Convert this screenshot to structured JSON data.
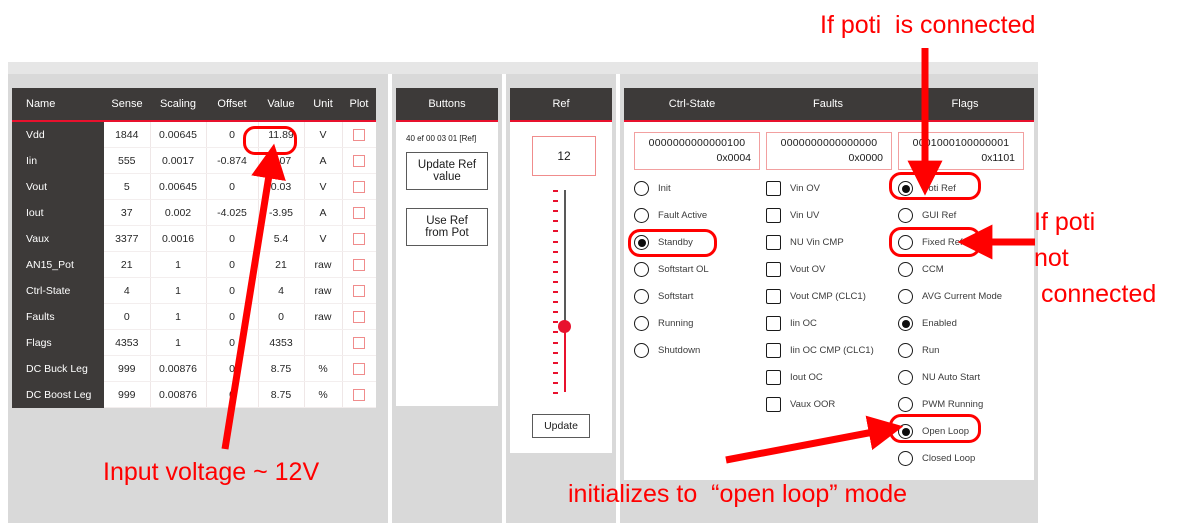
{
  "table": {
    "columns": [
      "Name",
      "Sense",
      "Scaling",
      "Offset",
      "Value",
      "Unit",
      "Plot"
    ],
    "rows": [
      {
        "name": "Vdd",
        "sense": "1844",
        "scaling": "0.00645",
        "offset": "0",
        "value": "11.89",
        "unit": "V"
      },
      {
        "name": "Iin",
        "sense": "555",
        "scaling": "0.0017",
        "offset": "-0.874",
        "value": "0.07",
        "unit": "A"
      },
      {
        "name": "Vout",
        "sense": "5",
        "scaling": "0.00645",
        "offset": "0",
        "value": "0.03",
        "unit": "V"
      },
      {
        "name": "Iout",
        "sense": "37",
        "scaling": "0.002",
        "offset": "-4.025",
        "value": "-3.95",
        "unit": "A"
      },
      {
        "name": "Vaux",
        "sense": "3377",
        "scaling": "0.0016",
        "offset": "0",
        "value": "5.4",
        "unit": "V"
      },
      {
        "name": "AN15_Pot",
        "sense": "21",
        "scaling": "1",
        "offset": "0",
        "value": "21",
        "unit": "raw"
      },
      {
        "name": "Ctrl-State",
        "sense": "4",
        "scaling": "1",
        "offset": "0",
        "value": "4",
        "unit": "raw"
      },
      {
        "name": "Faults",
        "sense": "0",
        "scaling": "1",
        "offset": "0",
        "value": "0",
        "unit": "raw"
      },
      {
        "name": "Flags",
        "sense": "4353",
        "scaling": "1",
        "offset": "0",
        "value": "4353",
        "unit": ""
      },
      {
        "name": "DC Buck Leg",
        "sense": "999",
        "scaling": "0.00876",
        "offset": "0",
        "value": "8.75",
        "unit": "%"
      },
      {
        "name": "DC Boost Leg",
        "sense": "999",
        "scaling": "0.00876",
        "offset": "0",
        "value": "8.75",
        "unit": "%"
      }
    ]
  },
  "buttons": {
    "title": "Buttons",
    "hex_line": "40 ef 00 03 01 [Ref]",
    "update_ref_value": "Update Ref value",
    "use_ref_from_pot": "Use Ref from Pot"
  },
  "ref": {
    "title": "Ref",
    "value": "12",
    "update": "Update"
  },
  "ctrl_state": {
    "title": "Ctrl-State",
    "binary": "0000000000000100",
    "hex": "0x0004",
    "options": [
      {
        "label": "Init",
        "selected": false
      },
      {
        "label": "Fault Active",
        "selected": false
      },
      {
        "label": "Standby",
        "selected": true
      },
      {
        "label": "Softstart OL",
        "selected": false
      },
      {
        "label": "Softstart",
        "selected": false
      },
      {
        "label": "Running",
        "selected": false
      },
      {
        "label": "Shutdown",
        "selected": false
      }
    ]
  },
  "faults": {
    "title": "Faults",
    "binary": "0000000000000000",
    "hex": "0x0000",
    "options": [
      {
        "label": "Vin OV",
        "checked": false
      },
      {
        "label": "Vin UV",
        "checked": false
      },
      {
        "label": "NU Vin CMP",
        "checked": false
      },
      {
        "label": "Vout OV",
        "checked": false
      },
      {
        "label": "Vout CMP (CLC1)",
        "checked": false
      },
      {
        "label": "Iin OC",
        "checked": false
      },
      {
        "label": "Iin OC CMP (CLC1)",
        "checked": false
      },
      {
        "label": "Iout OC",
        "checked": false
      },
      {
        "label": "Vaux OOR",
        "checked": false
      }
    ]
  },
  "flags": {
    "title": "Flags",
    "binary": "0001000100000001",
    "hex": "0x1101",
    "options": [
      {
        "label": "Poti Ref",
        "selected": true
      },
      {
        "label": "GUI Ref",
        "selected": false
      },
      {
        "label": "Fixed Ref",
        "selected": false
      },
      {
        "label": "CCM",
        "selected": false
      },
      {
        "label": "AVG Current Mode",
        "selected": false
      },
      {
        "label": "Enabled",
        "selected": true
      },
      {
        "label": "Run",
        "selected": false
      },
      {
        "label": "NU Auto Start",
        "selected": false
      },
      {
        "label": "PWM Running",
        "selected": false
      },
      {
        "label": "Open Loop",
        "selected": true
      },
      {
        "label": "Closed Loop",
        "selected": false
      }
    ]
  },
  "annotations": {
    "poti_connected": "If poti  is connected",
    "poti_not_connected_l1": "If poti",
    "poti_not_connected_l2": "not",
    "poti_not_connected_l3": " connected",
    "input_voltage": "Input voltage ~ 12V",
    "open_loop_mode": "initializes to  “open loop” mode"
  },
  "colors": {
    "accent_red": "#e8112d",
    "annotation_red": "#ff0000",
    "header_dark": "#3d3a39",
    "page_grey": "#d9d9d9"
  }
}
